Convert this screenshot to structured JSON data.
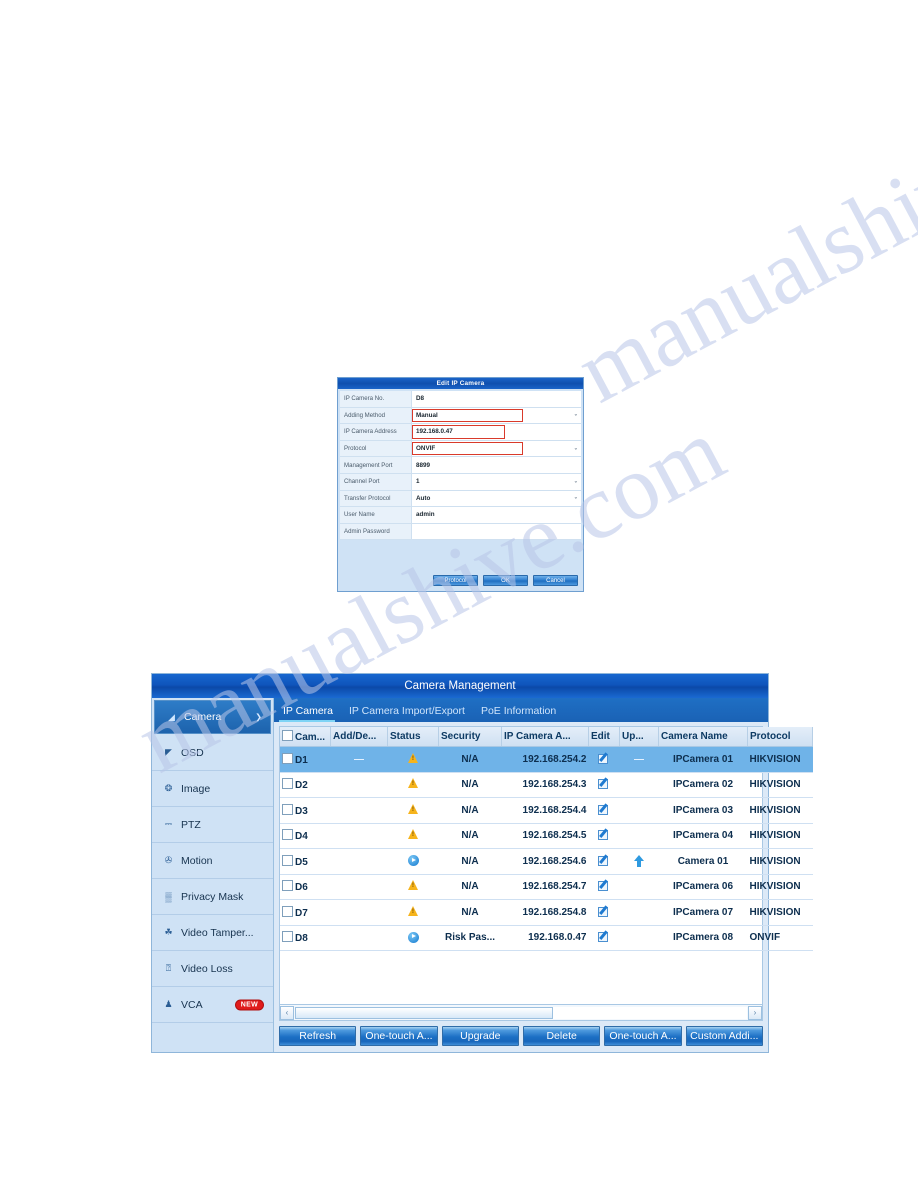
{
  "watermark": {
    "line1": "manualshive.com",
    "line2": "manualshive.com"
  },
  "dialog": {
    "title": "Edit IP Camera",
    "fields": [
      {
        "label": "IP Camera No.",
        "value": "D8",
        "dropdown": false,
        "highlight": "none"
      },
      {
        "label": "Adding Method",
        "value": "Manual",
        "dropdown": true,
        "highlight": "wide"
      },
      {
        "label": "IP Camera Address",
        "value": "192.168.0.47",
        "dropdown": false,
        "highlight": "mid"
      },
      {
        "label": "Protocol",
        "value": "ONVIF",
        "dropdown": true,
        "highlight": "wide"
      },
      {
        "label": "Management Port",
        "value": "8899",
        "dropdown": false,
        "highlight": "none"
      },
      {
        "label": "Channel Port",
        "value": "1",
        "dropdown": true,
        "highlight": "none"
      },
      {
        "label": "Transfer Protocol",
        "value": "Auto",
        "dropdown": true,
        "highlight": "none"
      },
      {
        "label": "User Name",
        "value": "admin",
        "dropdown": false,
        "highlight": "none"
      },
      {
        "label": "Admin Password",
        "value": "",
        "dropdown": false,
        "highlight": "none"
      }
    ],
    "buttons": [
      {
        "label": "Protocol"
      },
      {
        "label": "OK"
      },
      {
        "label": "Cancel"
      }
    ],
    "highlight_color": "#d93a2b"
  },
  "window": {
    "title": "Camera Management",
    "sidebar": {
      "items": [
        {
          "label": "Camera",
          "icon": "camera-icon",
          "active": true,
          "arrow": true,
          "badge": ""
        },
        {
          "label": "OSD",
          "icon": "osd-icon",
          "active": false,
          "arrow": false,
          "badge": ""
        },
        {
          "label": "Image",
          "icon": "image-icon",
          "active": false,
          "arrow": false,
          "badge": ""
        },
        {
          "label": "PTZ",
          "icon": "ptz-icon",
          "active": false,
          "arrow": false,
          "badge": ""
        },
        {
          "label": "Motion",
          "icon": "motion-icon",
          "active": false,
          "arrow": false,
          "badge": ""
        },
        {
          "label": "Privacy Mask",
          "icon": "privacy-mask-icon",
          "active": false,
          "arrow": false,
          "badge": ""
        },
        {
          "label": "Video Tamper...",
          "icon": "video-tamper-icon",
          "active": false,
          "arrow": false,
          "badge": ""
        },
        {
          "label": "Video Loss",
          "icon": "video-loss-icon",
          "active": false,
          "arrow": false,
          "badge": ""
        },
        {
          "label": "VCA",
          "icon": "vca-icon",
          "active": false,
          "arrow": false,
          "badge": "NEW"
        }
      ]
    },
    "tabs": [
      {
        "label": "IP Camera",
        "active": true
      },
      {
        "label": "IP Camera Import/Export",
        "active": false
      },
      {
        "label": "PoE Information",
        "active": false
      }
    ],
    "table": {
      "columns": [
        "Cam...",
        "Add/De...",
        "Status",
        "Security",
        "IP Camera A...",
        "Edit",
        "Up...",
        "Camera Name",
        "Protocol"
      ],
      "rows": [
        {
          "cam": "D1",
          "add": "dash",
          "status": "warning",
          "security": "N/A",
          "ip": "192.168.254.2",
          "edit": "edit-icon",
          "upgrade": "dash",
          "name": "IPCamera 01",
          "protocol": "HIKVISION",
          "selected": true
        },
        {
          "cam": "D2",
          "add": "",
          "status": "warning",
          "security": "N/A",
          "ip": "192.168.254.3",
          "edit": "edit-icon",
          "upgrade": "",
          "name": "IPCamera 02",
          "protocol": "HIKVISION",
          "selected": false
        },
        {
          "cam": "D3",
          "add": "",
          "status": "warning",
          "security": "N/A",
          "ip": "192.168.254.4",
          "edit": "edit-icon",
          "upgrade": "",
          "name": "IPCamera 03",
          "protocol": "HIKVISION",
          "selected": false
        },
        {
          "cam": "D4",
          "add": "",
          "status": "warning",
          "security": "N/A",
          "ip": "192.168.254.5",
          "edit": "edit-icon",
          "upgrade": "",
          "name": "IPCamera 04",
          "protocol": "HIKVISION",
          "selected": false
        },
        {
          "cam": "D5",
          "add": "",
          "status": "play",
          "security": "N/A",
          "ip": "192.168.254.6",
          "edit": "edit-icon",
          "upgrade": "up-arrow",
          "name": "Camera 01",
          "protocol": "HIKVISION",
          "selected": false
        },
        {
          "cam": "D6",
          "add": "",
          "status": "warning",
          "security": "N/A",
          "ip": "192.168.254.7",
          "edit": "edit-icon",
          "upgrade": "",
          "name": "IPCamera 06",
          "protocol": "HIKVISION",
          "selected": false
        },
        {
          "cam": "D7",
          "add": "",
          "status": "warning",
          "security": "N/A",
          "ip": "192.168.254.8",
          "edit": "edit-icon",
          "upgrade": "",
          "name": "IPCamera 07",
          "protocol": "HIKVISION",
          "selected": false
        },
        {
          "cam": "D8",
          "add": "",
          "status": "play",
          "security": "Risk Pas...",
          "ip": "192.168.0.47",
          "edit": "edit-icon",
          "upgrade": "",
          "name": "IPCamera 08",
          "protocol": "ONVIF",
          "selected": false
        }
      ]
    },
    "scrollbar": {
      "left_arrow": "‹",
      "right_arrow": "›"
    },
    "buttons": [
      {
        "label": "Refresh"
      },
      {
        "label": "One-touch A..."
      },
      {
        "label": "Upgrade"
      },
      {
        "label": "Delete"
      },
      {
        "label": "One-touch A..."
      },
      {
        "label": "Custom Addi..."
      }
    ]
  }
}
